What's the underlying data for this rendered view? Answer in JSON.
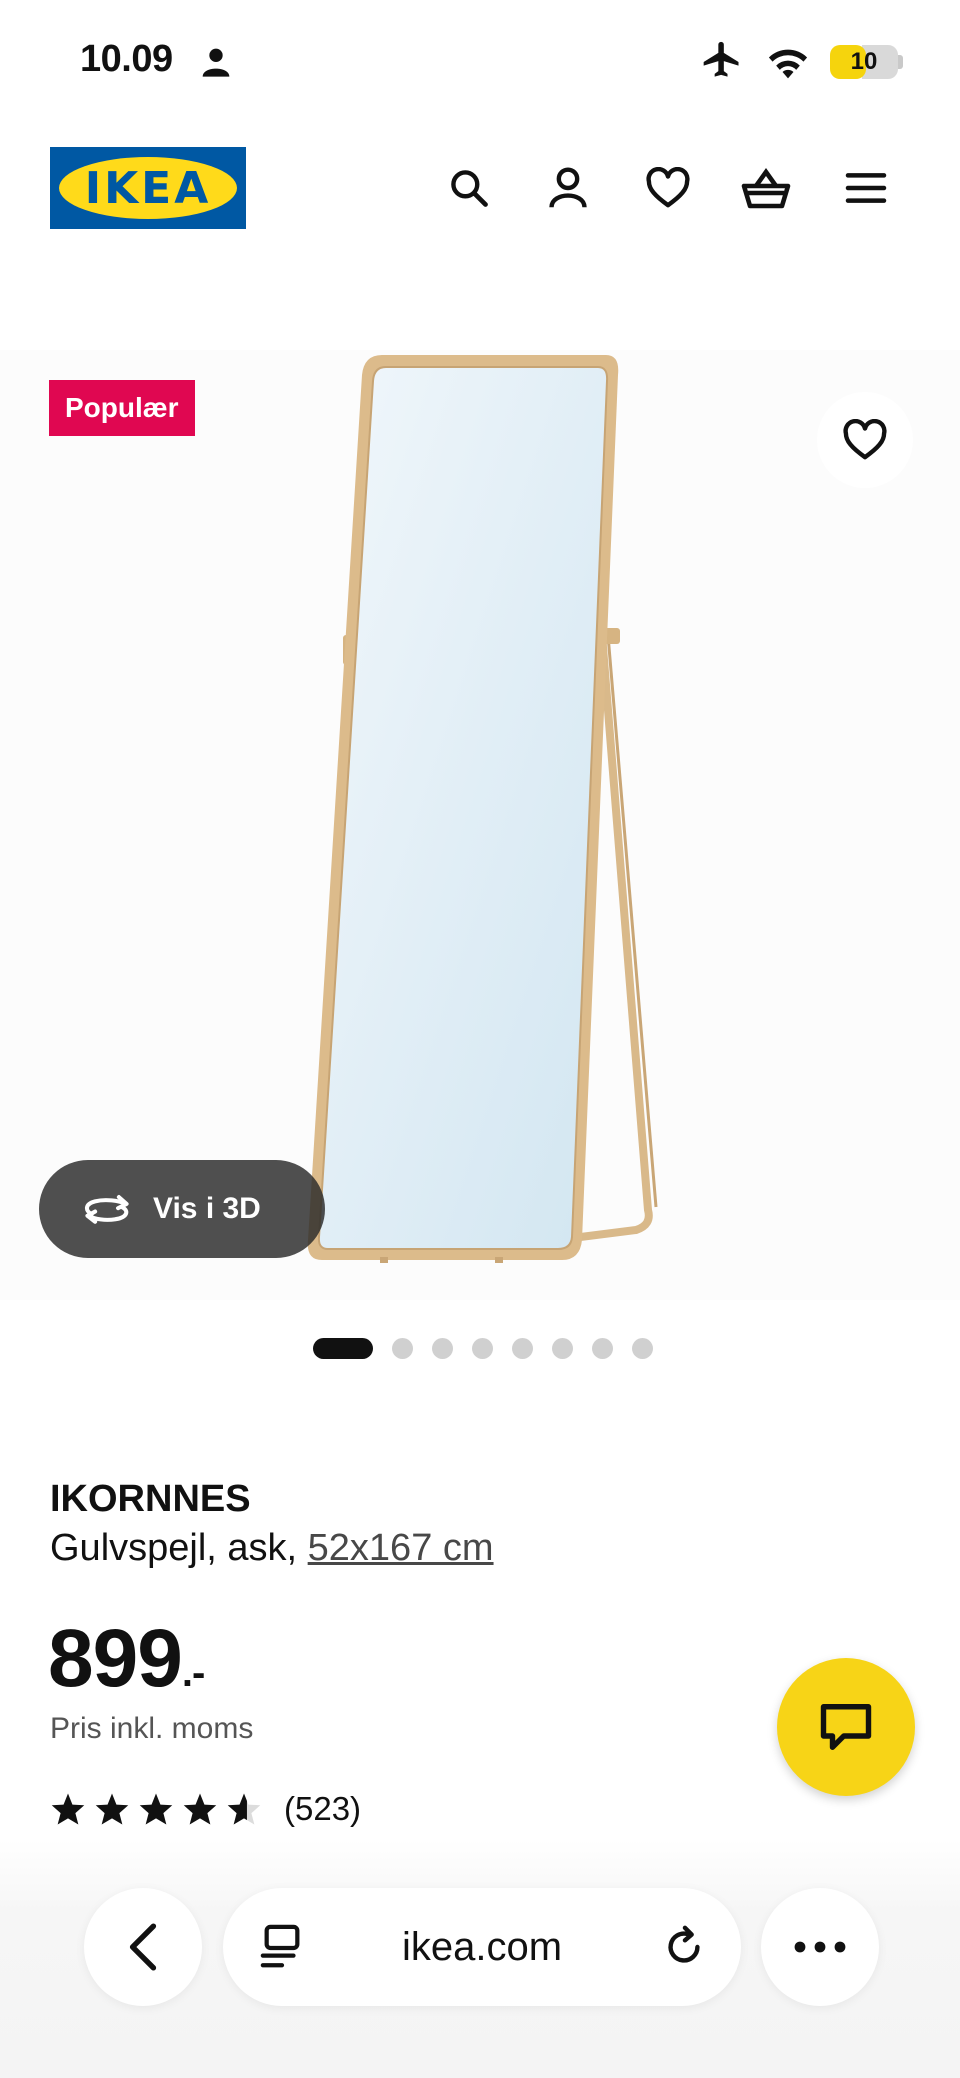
{
  "status_bar": {
    "time": "10.09",
    "battery": "10",
    "icons": [
      "person-icon",
      "airplane-mode-icon",
      "wifi-icon",
      "battery-icon"
    ]
  },
  "header": {
    "logo_text": "IKEA",
    "icons": [
      "search-icon",
      "account-icon",
      "heart-icon",
      "basket-icon",
      "menu-icon"
    ]
  },
  "product_image": {
    "badge": "Populær",
    "view_3d_label": "Vis i 3D",
    "carousel": {
      "count": 8,
      "active_index": 0
    }
  },
  "product": {
    "name": "IKORNNES",
    "description": "Gulvspejl, ask, ",
    "size": "52x167 cm",
    "price": "899",
    "price_suffix": ".-",
    "price_note": "Pris inkl. moms",
    "rating": {
      "stars": 4.5,
      "max": 5,
      "count": "(523)"
    }
  },
  "browser": {
    "url": "ikea.com"
  },
  "colors": {
    "ikea_blue": "#0058a3",
    "ikea_yellow": "#ffda1a",
    "badge_red": "#e00751",
    "chat_yellow": "#f7d417"
  }
}
